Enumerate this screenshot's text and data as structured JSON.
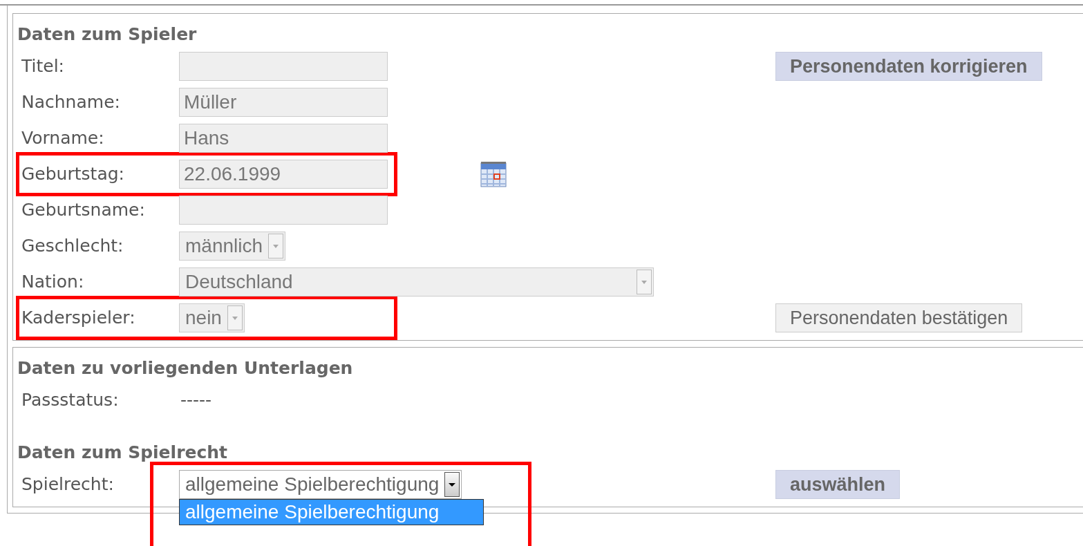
{
  "sections": [
    {
      "title": "Daten zum Spieler",
      "blocks": [
        {
          "rows": [
            {
              "label": "Titel:",
              "kind": "input",
              "disabled": true,
              "button": {
                "label": "Personendaten korrigieren",
                "kind": "primary"
              }
            },
            {
              "label": "Nachname:",
              "kind": "input",
              "disabled": true,
              "value": "Müller"
            },
            {
              "label": "Vorname:",
              "kind": "input",
              "disabled": true,
              "value": "Hans"
            },
            {
              "label": "Geburtstag:",
              "kind": "input",
              "disabled": true,
              "value": "22.06.1999",
              "highlighted": true,
              "calendar": true
            },
            {
              "label": "Geburtsname:",
              "kind": "input",
              "disabled": true
            },
            {
              "label": "Geschlecht:",
              "kind": "select",
              "disabled": true,
              "value": "männlich"
            },
            {
              "label": "Nation:",
              "kind": "select",
              "disabled": true,
              "value": "Deutschland",
              "wide": true
            },
            {
              "label": "Kaderspieler:",
              "kind": "select",
              "disabled": true,
              "value": "nein",
              "highlighted": true,
              "button": {
                "label": "Personendaten bestätigen",
                "kind": "plain"
              }
            }
          ]
        }
      ]
    },
    {
      "title": "Daten zu vorliegenden Unterlagen",
      "blocks": [
        {
          "rows": [
            {
              "label": "Passstatus:",
              "kind": "text",
              "value": "-----"
            }
          ]
        },
        {
          "heading": "Daten zum Spielrecht",
          "rows": [
            {
              "label": "Spielrecht:",
              "kind": "select",
              "disabled": false,
              "value": "allgemeine Spielberechtigung",
              "highlighted": true,
              "expanded": true,
              "options": [
                {
                  "label": "allgemeine Spielberechtigung",
                  "selected": true
                }
              ],
              "button": {
                "label": "auswählen",
                "kind": "primary"
              }
            }
          ]
        }
      ]
    }
  ]
}
